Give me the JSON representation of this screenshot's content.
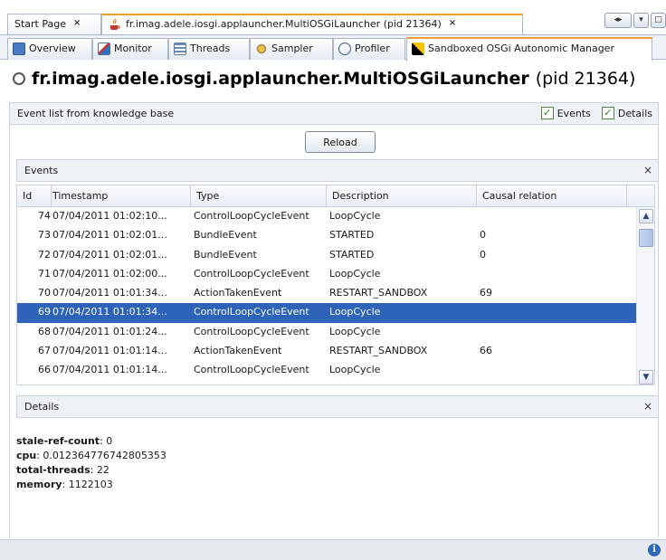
{
  "top_tabs": [
    {
      "label": "Start Page",
      "active": false
    },
    {
      "label": "fr.imag.adele.iosgi.applauncher.MultiOSGiLauncher (pid 21364)",
      "active": true
    }
  ],
  "view_tabs": [
    {
      "label": "Overview",
      "icon": "overview-icon"
    },
    {
      "label": "Monitor",
      "icon": "monitor-icon"
    },
    {
      "label": "Threads",
      "icon": "threads-icon"
    },
    {
      "label": "Sampler",
      "icon": "sampler-icon"
    },
    {
      "label": "Profiler",
      "icon": "profiler-icon"
    },
    {
      "label": "Sandboxed OSGi Autonomic Manager",
      "icon": "osgi-manager-icon"
    }
  ],
  "title": {
    "app": "fr.imag.adele.iosgi.applauncher.MultiOSGiLauncher",
    "pid": "(pid 21364)"
  },
  "kb_bar": {
    "label": "Event list from knowledge base",
    "events_checkbox": {
      "label": "Events",
      "checked": true
    },
    "details_checkbox": {
      "label": "Details",
      "checked": true
    }
  },
  "reload_label": "Reload",
  "events_section": {
    "label": "Events"
  },
  "table": {
    "columns": [
      "Id",
      "Timestamp",
      "Type",
      "Description",
      "Causal relation"
    ],
    "rows": [
      {
        "id": "74",
        "timestamp": "07/04/2011 01:02:10...",
        "type": "ControlLoopCycleEvent",
        "description": "LoopCycle",
        "cause": "",
        "selected": false
      },
      {
        "id": "73",
        "timestamp": "07/04/2011 01:02:01...",
        "type": "BundleEvent",
        "description": "STARTED",
        "cause": "0",
        "selected": false
      },
      {
        "id": "72",
        "timestamp": "07/04/2011 01:02:01...",
        "type": "BundleEvent",
        "description": "STARTED",
        "cause": "0",
        "selected": false
      },
      {
        "id": "71",
        "timestamp": "07/04/2011 01:02:00...",
        "type": "ControlLoopCycleEvent",
        "description": "LoopCycle",
        "cause": "",
        "selected": false
      },
      {
        "id": "70",
        "timestamp": "07/04/2011 01:01:34...",
        "type": "ActionTakenEvent",
        "description": "RESTART_SANDBOX",
        "cause": "69",
        "selected": false
      },
      {
        "id": "69",
        "timestamp": "07/04/2011 01:01:34...",
        "type": "ControlLoopCycleEvent",
        "description": "LoopCycle",
        "cause": "",
        "selected": true
      },
      {
        "id": "68",
        "timestamp": "07/04/2011 01:01:24...",
        "type": "ControlLoopCycleEvent",
        "description": "LoopCycle",
        "cause": "",
        "selected": false
      },
      {
        "id": "67",
        "timestamp": "07/04/2011 01:01:14...",
        "type": "ActionTakenEvent",
        "description": "RESTART_SANDBOX",
        "cause": "66",
        "selected": false
      },
      {
        "id": "66",
        "timestamp": "07/04/2011 01:01:14...",
        "type": "ControlLoopCycleEvent",
        "description": "LoopCycle",
        "cause": "",
        "selected": false
      }
    ]
  },
  "details_section": {
    "label": "Details"
  },
  "details": [
    {
      "key": "stale-ref-count",
      "value": ": 0"
    },
    {
      "key": "cpu",
      "value": ": 0.012364776742805353"
    },
    {
      "key": "total-threads",
      "value": ": 22"
    },
    {
      "key": "memory",
      "value": ": 1122103"
    }
  ],
  "colors": {
    "accent_tab": "#f0a030",
    "selection": "#2d63b8",
    "info": "#2d6ab8"
  }
}
